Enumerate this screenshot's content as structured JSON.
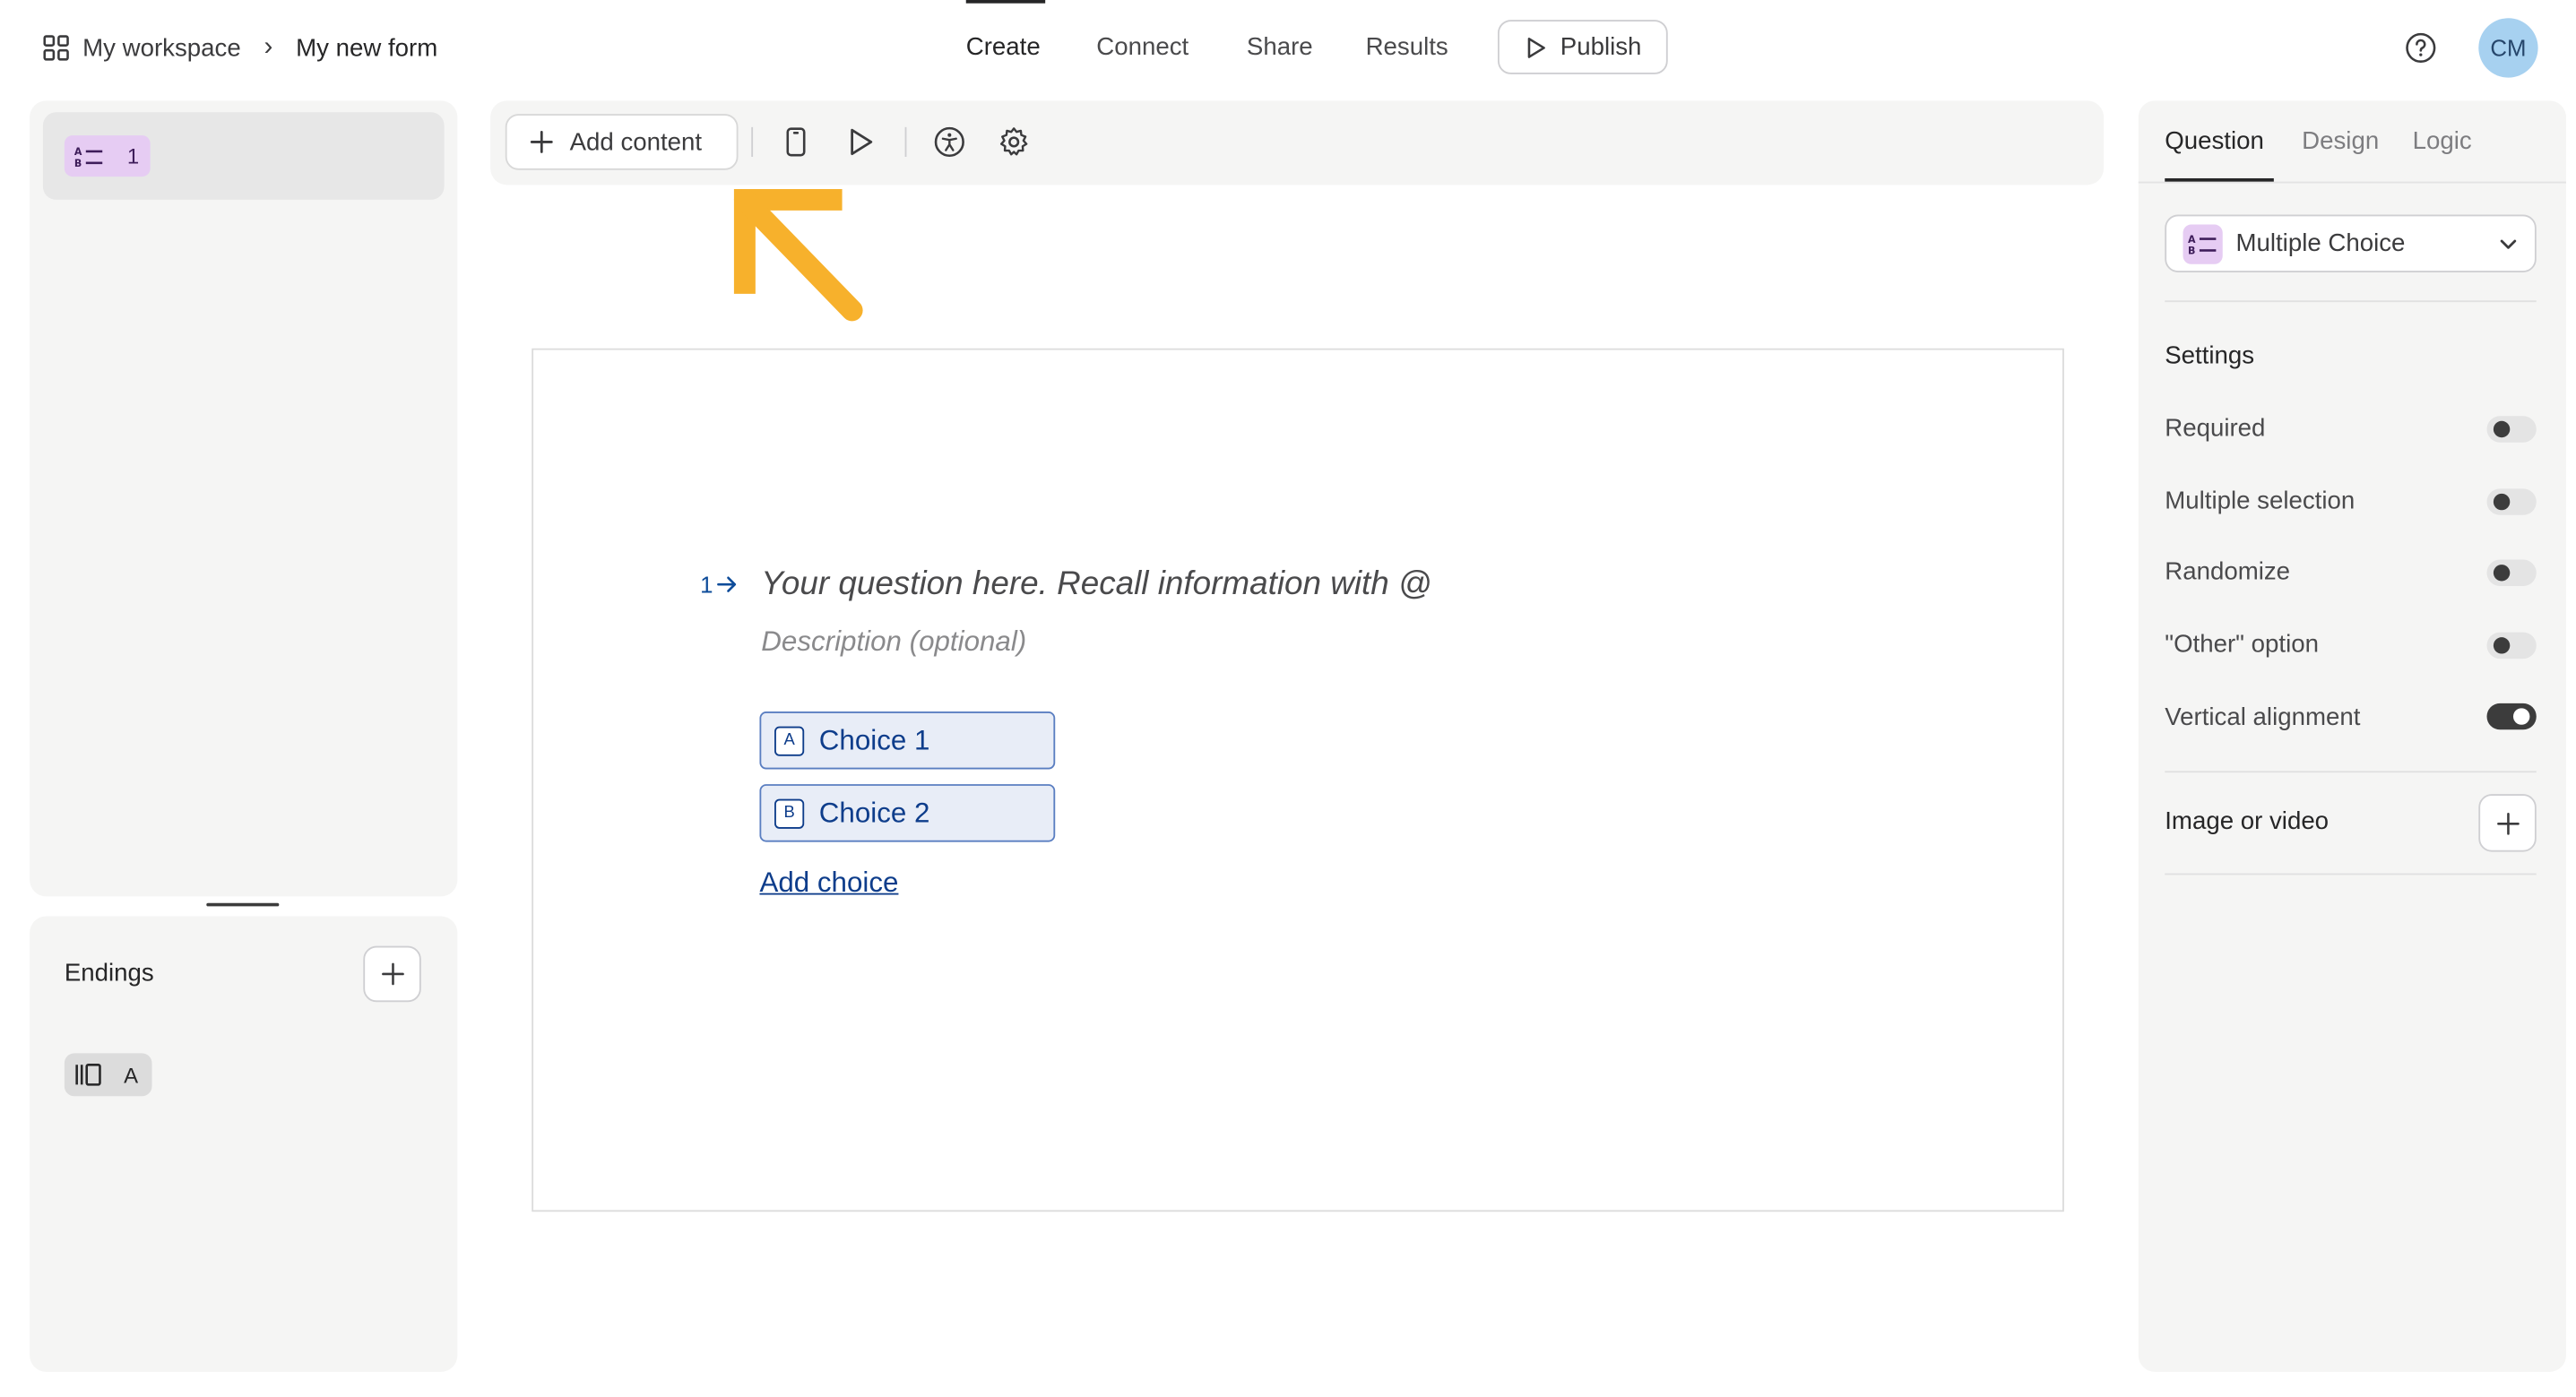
{
  "breadcrumb": {
    "workspace": "My workspace",
    "separator": "›",
    "form": "My new form"
  },
  "nav": {
    "create": "Create",
    "connect": "Connect",
    "share": "Share",
    "results": "Results"
  },
  "publish": {
    "label": "Publish"
  },
  "user": {
    "initials": "CM"
  },
  "sidebar": {
    "questions": [
      {
        "number": "1",
        "type_icon": "multiple-choice-icon"
      }
    ],
    "endings": {
      "title": "Endings",
      "items": [
        {
          "label": "A",
          "icon": "ending-icon"
        }
      ]
    }
  },
  "toolbar": {
    "add_content": "Add content",
    "icons": [
      "mobile-preview-icon",
      "play-preview-icon",
      "accessibility-icon",
      "settings-icon"
    ]
  },
  "annotation": {
    "color": "#f7b12c",
    "icon": "arrow-pointer-icon"
  },
  "question": {
    "number": "1",
    "title_placeholder": "Your question here. Recall information with @",
    "description_placeholder": "Description (optional)",
    "choices": [
      {
        "key": "A",
        "label": "Choice 1"
      },
      {
        "key": "B",
        "label": "Choice 2"
      }
    ],
    "add_choice": "Add choice"
  },
  "right_panel": {
    "tabs": [
      "Question",
      "Design",
      "Logic"
    ],
    "active_tab": "Question",
    "question_type": "Multiple Choice",
    "settings_title": "Settings",
    "settings": [
      {
        "label": "Required",
        "on": false
      },
      {
        "label": "Multiple selection",
        "on": false
      },
      {
        "label": "Randomize",
        "on": false
      },
      {
        "label": "\"Other\" option",
        "on": false
      },
      {
        "label": "Vertical alignment",
        "on": true
      }
    ],
    "media_label": "Image or video"
  }
}
